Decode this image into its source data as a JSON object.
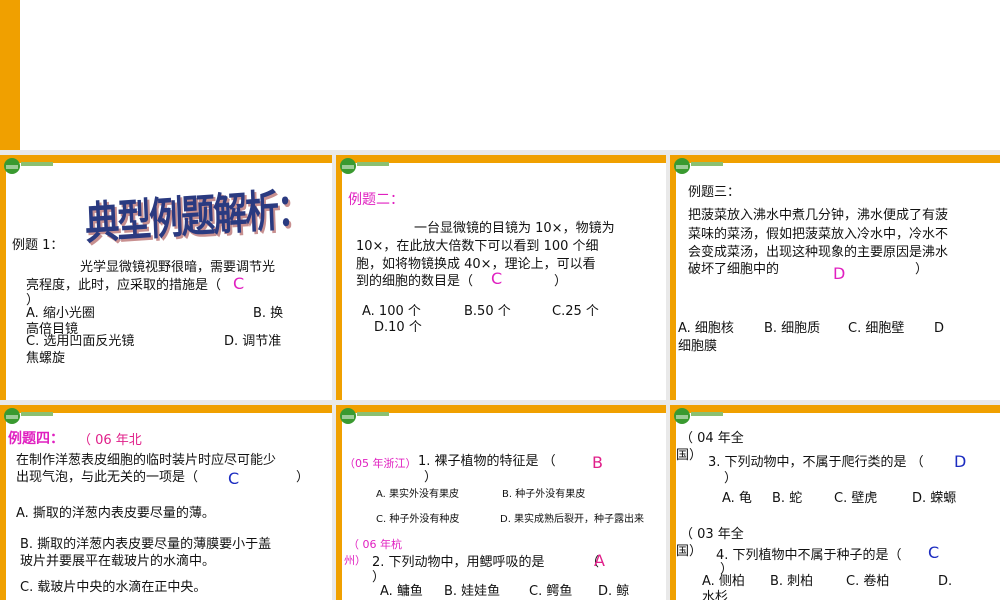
{
  "slides": [
    {
      "title": "典型例题解析：",
      "label": "例题 1：",
      "q1": "光学显微镜视野很暗，需要调节光",
      "q2": "亮程度，此时，应采取的措施是（",
      "q3": "）",
      "answer": "C",
      "oa": "A. 缩小光圈",
      "ob": "B.  换",
      "ob2": "高倍目镜",
      "oc": "C. 选用凹面反光镜",
      "od": "D. 调节准",
      "od2": "焦螺旋"
    },
    {
      "label": "例题二：",
      "q1": "一台显微镜的目镜为 10×，物镜为",
      "q2": "10×，在此放大倍数下可以看到 100 个细",
      "q3": "胞，如将物镜换成 40×，理论上，可以看",
      "q4": "到的细胞的数目是（",
      "q5": "）",
      "answer": "C",
      "oa": "A. 100 个",
      "ob": "B.50 个",
      "oc": "C.25 个",
      "od": "D.10 个"
    },
    {
      "label": "例题三：",
      "q1": "把菠菜放入沸水中煮几分钟，沸水便成了有菠",
      "q2": "菜味的菜汤，假如把菠菜放入冷水中，冷水不",
      "q3": "会变成菜汤，出现这种现象的主要原因是沸水",
      "q4": "破坏了细胞中的",
      "q5": "）",
      "answer": "D",
      "oa": "A. 细胞核",
      "ob": "B.  细胞质",
      "oc": "C.  细胞壁",
      "od": "D",
      "od2": "细胞膜"
    },
    {
      "label": "例题四：",
      "src": "（ 06 年北",
      "q1": "在制作洋葱表皮细胞的临时装片时应尽可能少",
      "q2": "出现气泡，与此无关的一项是（",
      "q3": "）",
      "answer": "C",
      "oa": "A. 撕取的洋葱内表皮要尽量的薄。",
      "ob1": "B. 撕取的洋葱内表皮要尽量的薄膜要小于盖",
      "ob2": "玻片并要展平在载玻片的水滴中。",
      "oc": "C. 载玻片中央的水滴在正中央。"
    },
    {
      "src1": "（05 年浙江）",
      "q1": "1.    裸子植物的特征是  （",
      "q1b": "）",
      "answer1": "B",
      "o1a": "A. 果实外没有果皮",
      "o1b": "B.  种子外没有果皮",
      "o1c": "C.  种子外没有种皮",
      "o1d": "D.  果实成熟后裂开，种子露出来",
      "src2a": "（ 06 年杭",
      "src2b": "州）",
      "q2": "2. 下列动物中，用鳃呼吸的是",
      "q2b": "（",
      "q2c": "）",
      "answer2": "A",
      "o2a": "A. 鳙鱼",
      "o2b": "B.  娃娃鱼",
      "o2c": "C.  鳄鱼",
      "o2d": "D. 鲸"
    },
    {
      "src1a": "（ 04 年全",
      "src1b": "国）",
      "q1": "3. 下列动物中，不属于爬行类的是  （",
      "q1b": "）",
      "answer1": "D",
      "o1a": "A. 龟",
      "o1b": "B.  蛇",
      "o1c": "C.  壁虎",
      "o1d": "D.  蝾螈",
      "src2a": "（ 03 年全",
      "src2b": "国）",
      "q2": "4. 下列植物中不属于种子的是（",
      "q2b": "）",
      "answer2": "C",
      "o2a": "A.  侧柏",
      "o2b": "B.  刺柏",
      "o2c": "C.  卷柏",
      "o2d": "D.",
      "o2e": "水杉"
    }
  ]
}
